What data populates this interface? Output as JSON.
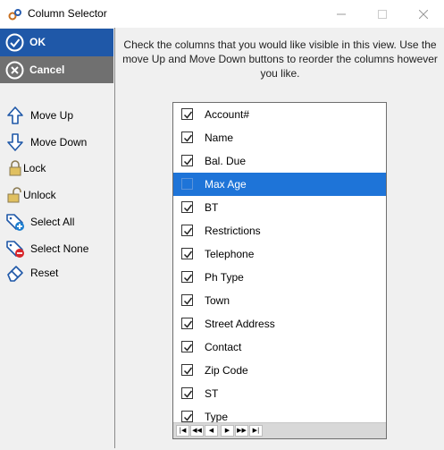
{
  "window": {
    "title": "Column Selector"
  },
  "buttons": {
    "ok": "OK",
    "cancel": "Cancel"
  },
  "tools": [
    {
      "label": "Move Up",
      "icon": "arrow-up-icon"
    },
    {
      "label": "Move Down",
      "icon": "arrow-down-icon"
    },
    {
      "label": "Lock",
      "icon": "lock-icon"
    },
    {
      "label": "Unlock",
      "icon": "unlock-icon"
    },
    {
      "label": "Select All",
      "icon": "tag-add-icon"
    },
    {
      "label": "Select None",
      "icon": "tag-remove-icon"
    },
    {
      "label": "Reset",
      "icon": "eraser-icon"
    }
  ],
  "instructions": "Check the columns that you would like visible in this view. Use the move Up and Move Down buttons to reorder the columns however you like.",
  "columns": [
    {
      "name": "Account#",
      "checked": true
    },
    {
      "name": "Name",
      "checked": true
    },
    {
      "name": "Bal. Due",
      "checked": true
    },
    {
      "name": "Max Age",
      "checked": false,
      "selected": true
    },
    {
      "name": "BT",
      "checked": true
    },
    {
      "name": "Restrictions",
      "checked": true
    },
    {
      "name": "Telephone",
      "checked": true
    },
    {
      "name": "Ph Type",
      "checked": true
    },
    {
      "name": "Town",
      "checked": true
    },
    {
      "name": "Street Address",
      "checked": true
    },
    {
      "name": "Contact",
      "checked": true
    },
    {
      "name": "Zip Code",
      "checked": true
    },
    {
      "name": "ST",
      "checked": true
    },
    {
      "name": "Type",
      "checked": true
    }
  ],
  "pager": [
    "first",
    "prev-page",
    "prev",
    "next",
    "next-page",
    "last"
  ],
  "colors": {
    "ok": "#1f58a8",
    "cancel": "#707070",
    "selected_row": "#1e74d8"
  }
}
